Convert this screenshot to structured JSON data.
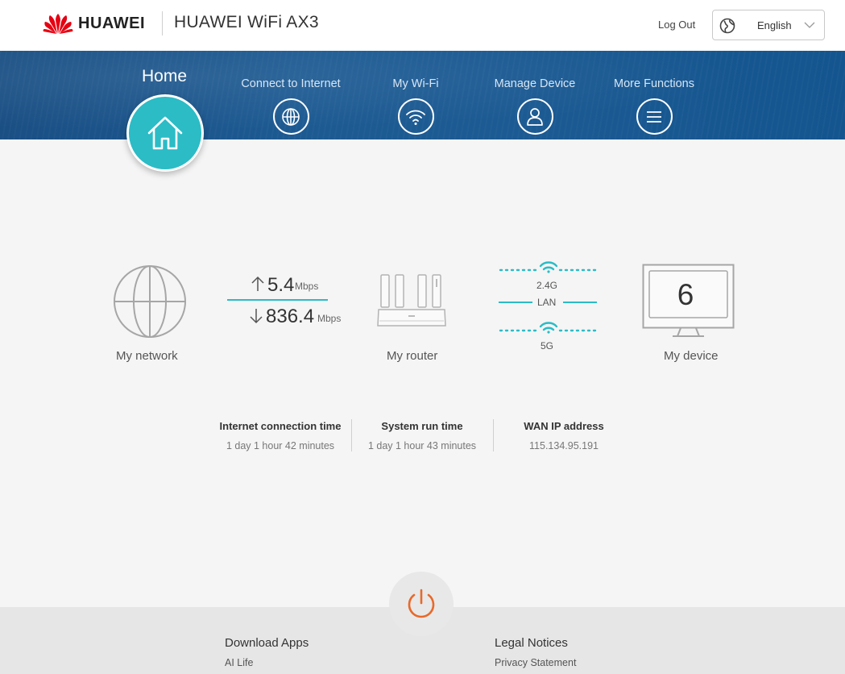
{
  "header": {
    "brand": "HUAWEI",
    "product": "HUAWEI WiFi AX3",
    "logout_label": "Log Out",
    "language": "English"
  },
  "nav": {
    "home_label": "Home",
    "items": [
      {
        "label": "Connect to Internet",
        "icon": "globe-icon"
      },
      {
        "label": "My Wi-Fi",
        "icon": "wifi-icon"
      },
      {
        "label": "Manage Device",
        "icon": "user-icon"
      },
      {
        "label": "More Functions",
        "icon": "menu-icon"
      }
    ]
  },
  "status": {
    "network_label": "My network",
    "upload": {
      "value": "5.4",
      "unit": "Mbps"
    },
    "download": {
      "value": "836.4",
      "unit": "Mbps"
    },
    "router_label": "My router",
    "bands": {
      "band_24": "2.4G",
      "lan": "LAN",
      "band_5": "5G"
    },
    "device_count": "6",
    "device_label": "My device"
  },
  "stats": [
    {
      "title": "Internet connection time",
      "value": "1 day 1 hour 42 minutes"
    },
    {
      "title": "System run time",
      "value": "1 day 1 hour 43 minutes"
    },
    {
      "title": "WAN IP address",
      "value": "115.134.95.191"
    }
  ],
  "footer": {
    "col1_title": "Download Apps",
    "col1_link": "AI Life",
    "col2_title": "Legal Notices",
    "col2_link": "Privacy Statement"
  },
  "colors": {
    "accent": "#2bbcc6",
    "nav_blue": "#1d5a92",
    "power_orange": "#e8692a",
    "huawei_red": "#e60012"
  }
}
